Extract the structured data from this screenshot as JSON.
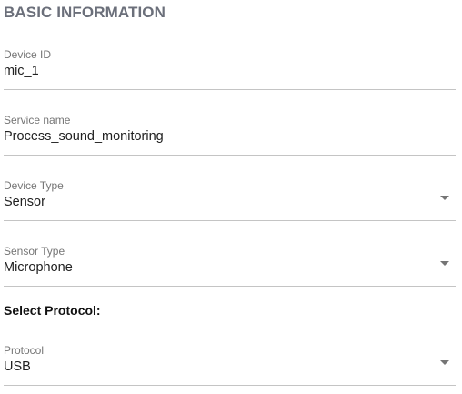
{
  "section": {
    "title": "BASIC INFORMATION"
  },
  "fields": {
    "device_id": {
      "label": "Device ID",
      "value": "mic_1"
    },
    "service_name": {
      "label": "Service name",
      "value": "Process_sound_monitoring"
    },
    "device_type": {
      "label": "Device Type",
      "value": "Sensor",
      "icon": "dropdown-arrow-icon"
    },
    "sensor_type": {
      "label": "Sensor Type",
      "value": "Microphone",
      "icon": "dropdown-arrow-icon"
    },
    "protocol": {
      "label": "Protocol",
      "value": "USB",
      "icon": "dropdown-arrow-icon"
    }
  },
  "protocol_section": {
    "heading": "Select Protocol:"
  }
}
